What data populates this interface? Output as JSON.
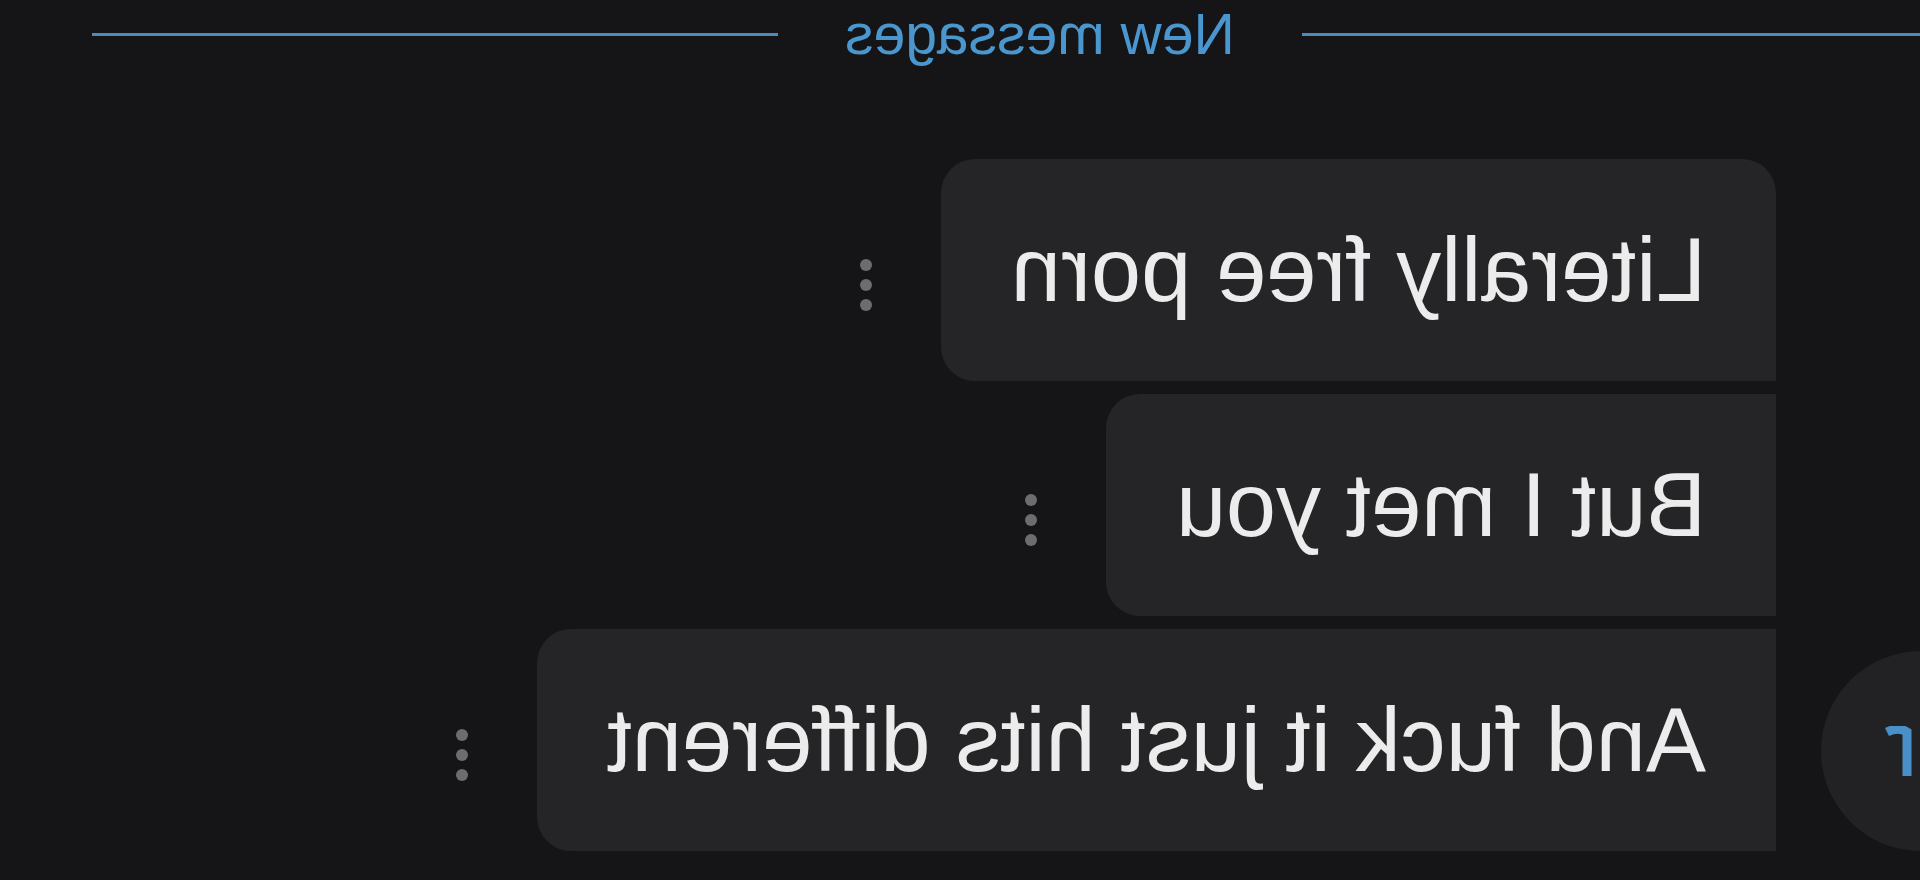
{
  "divider": {
    "label": "New messages"
  },
  "messages": [
    {
      "text": "Literally free porn"
    },
    {
      "text": "But I met you"
    },
    {
      "text": "And fuck it just hits different"
    }
  ]
}
